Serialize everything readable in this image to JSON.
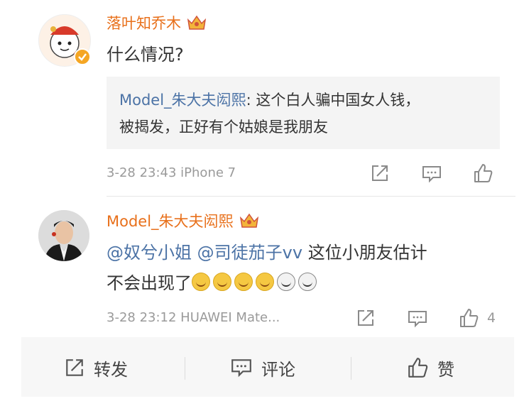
{
  "comment1": {
    "username": "落叶知乔木",
    "text": "什么情况?",
    "quote_user": "Model_朱大夫闳熙",
    "quote_line1_rest": ": 这个白人骗中国女人钱，",
    "quote_line2": "被揭发，正好有个姑娘是我朋友",
    "meta": "3-28 23:43 iPhone 7",
    "icons": [
      "forward-icon",
      "comment-icon",
      "like-icon"
    ]
  },
  "comment2": {
    "username": "Model_朱大夫闳熙",
    "mention1": "@奴兮小姐",
    "mention2": "@司徒茄子vv",
    "line1_rest": "这位小朋友估计",
    "line2": "不会出现了",
    "meta": "3-28 23:12 HUAWEI Mate...",
    "like_count": "4"
  },
  "bottom_bar": {
    "forward_label": "转发",
    "comment_label": "评论",
    "like_label": "赞"
  },
  "colors": {
    "username": "#e8701b",
    "mention": "#4c73a6",
    "meta": "#9a9a9a",
    "quote_bg": "#f4f4f4"
  }
}
